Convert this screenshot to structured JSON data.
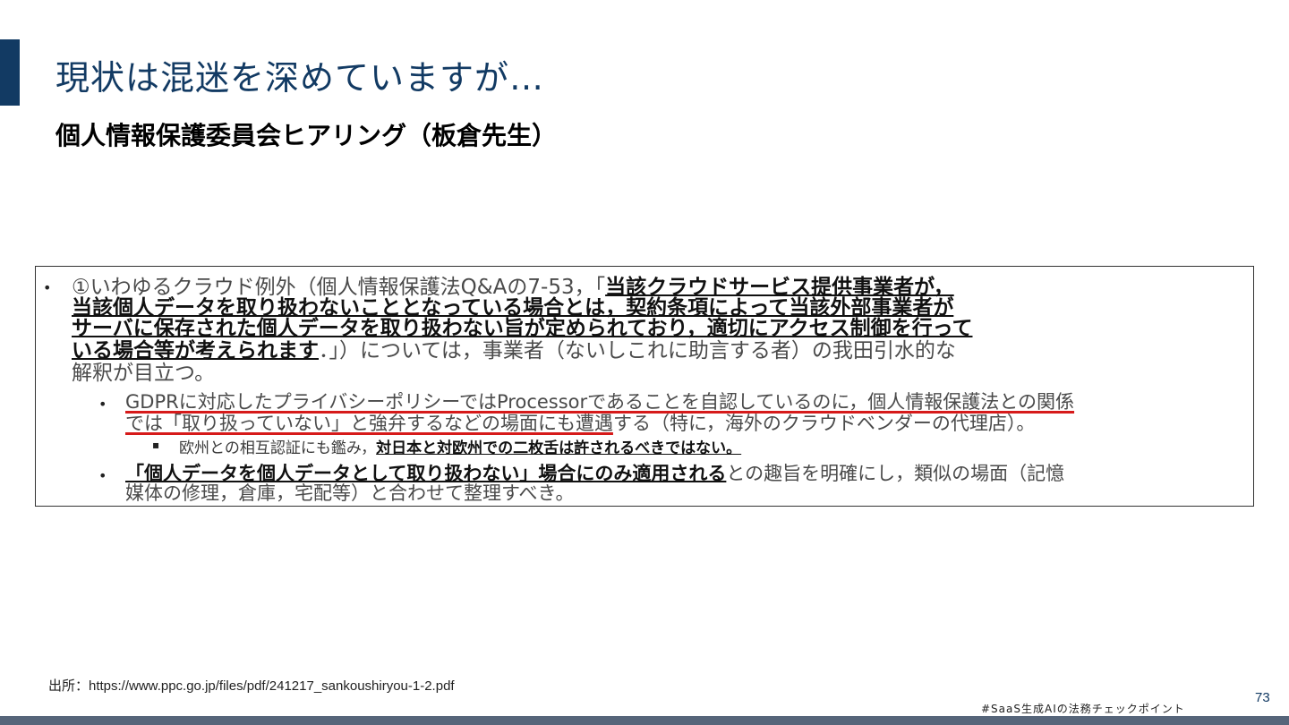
{
  "slide": {
    "title": "現状は混迷を深めていますが…",
    "subtitle": "個人情報保護委員会ヒアリング（板倉先生）",
    "page_number": "73",
    "hashtag": "#SaaS生成AIの法務チェックポイント",
    "source": "出所：https://www.ppc.go.jp/files/pdf/241217_sankoushiryou-1-2.pdf"
  },
  "excerpt": {
    "bullet_main": "•",
    "bullet_sub": "•",
    "bullet_sub2": "▪",
    "p1_line1_a": "①いわゆるクラウド例外（個人情報保護法Q&Aの7-53，「",
    "p1_line1_b": "当該クラウドサービス提供事業者が，",
    "p1_line2": "当該個人データを取り扱わないこととなっている場合とは，契約条項によって当該外部事業者が",
    "p1_line3": "サーバに保存された個人データを取り扱わない旨が定められており，適切にアクセス制御を行って",
    "p1_line4_a": "いる場合等が考えられます",
    "p1_line4_b": "．」）については，事業者（ないしこれに助言する者）の我田引水的な",
    "p1_line5": "解釈が目立つ。",
    "p2_line1": "GDPRに対応したプライバシーポリシーではProcessorであることを自認しているのに，個人情報保護法との関係",
    "p2_line2_a": "では「取り扱っていない」と強弁するなどの場面にも遭遇",
    "p2_line2_b": "する（特に，海外のクラウドベンダーの代理店）。",
    "p3_a": "欧州との相互認証にも鑑み，",
    "p3_b": "対日本と対欧州での二枚舌は許されるべきではない。",
    "p4_line1_a": "「個人データを個人データとして取り扱わない」場合にのみ適用される",
    "p4_line1_b": "との趣旨を明確にし，類似の場面（記憶",
    "p4_line2": "媒体の修理，倉庫，宅配等）と合わせて整理すべき。"
  },
  "colors": {
    "accent": "#123a63",
    "title": "#123a63",
    "underline_red": "#d61a1a",
    "footer": "#56657a"
  }
}
